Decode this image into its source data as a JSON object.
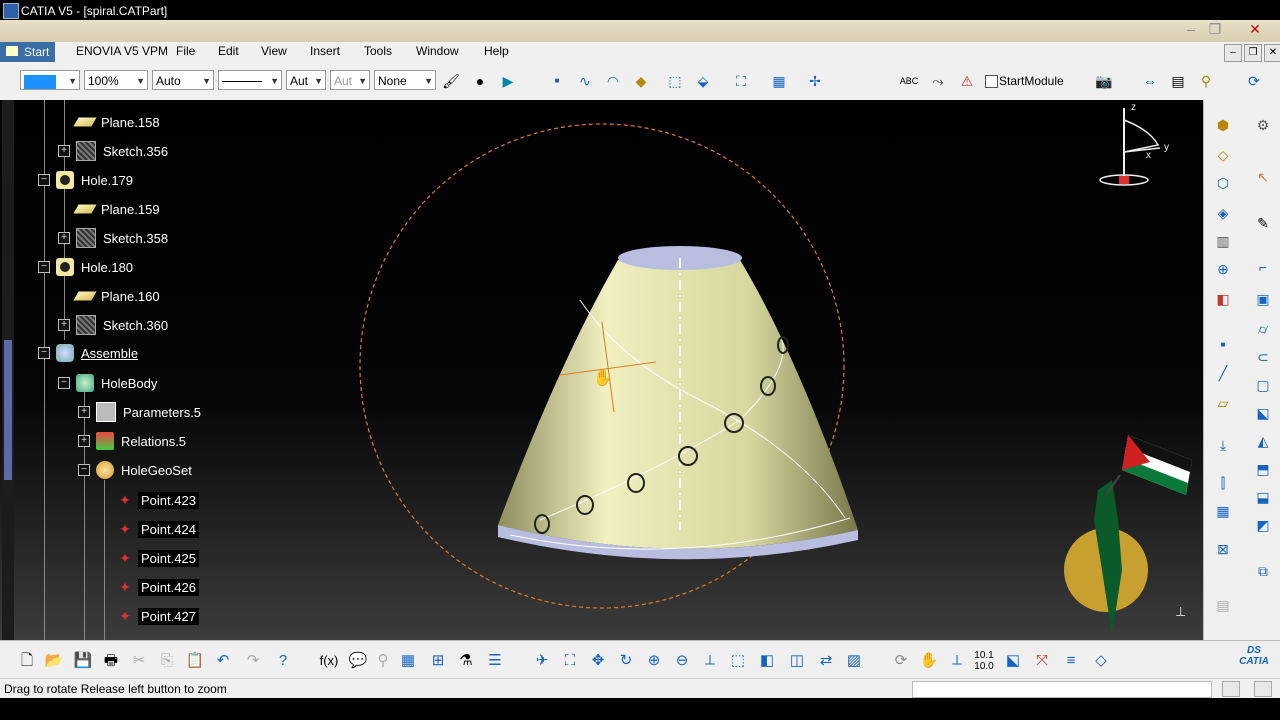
{
  "window": {
    "title": "CATIA V5 - [spiral.CATPart]"
  },
  "menu": [
    "Start",
    "ENOVIA V5 VPM",
    "File",
    "Edit",
    "View",
    "Insert",
    "Tools",
    "Window",
    "Help"
  ],
  "toolbar": {
    "zoom": "100%",
    "auto_label": "Auto",
    "aut1": "Aut",
    "aut2": "Aut",
    "none_label": "None",
    "startmodule": "StartModule"
  },
  "tree": [
    {
      "label": "Plane.158",
      "icon": "plane-icon"
    },
    {
      "label": "Sketch.356",
      "icon": "sketch-icon"
    },
    {
      "label": "Hole.179",
      "icon": "hole-icon"
    },
    {
      "label": "Plane.159",
      "icon": "plane-icon"
    },
    {
      "label": "Sketch.358",
      "icon": "sketch-icon"
    },
    {
      "label": "Hole.180",
      "icon": "hole-icon"
    },
    {
      "label": "Plane.160",
      "icon": "plane-icon"
    },
    {
      "label": "Sketch.360",
      "icon": "sketch-icon"
    },
    {
      "label": "Assemble",
      "icon": "assemble-icon"
    },
    {
      "label": "HoleBody",
      "icon": "body-icon"
    },
    {
      "label": "Parameters.5",
      "icon": "parameters-icon"
    },
    {
      "label": "Relations.5",
      "icon": "relations-icon"
    },
    {
      "label": "HoleGeoSet",
      "icon": "geoset-icon"
    },
    {
      "label": "Point.423",
      "icon": "point-icon"
    },
    {
      "label": "Point.424",
      "icon": "point-icon"
    },
    {
      "label": "Point.425",
      "icon": "point-icon"
    },
    {
      "label": "Point.426",
      "icon": "point-icon"
    },
    {
      "label": "Point.427",
      "icon": "point-icon"
    }
  ],
  "compass": {
    "z": "z",
    "x": "x",
    "y": "y"
  },
  "status": {
    "message": "Drag to rotate  Release left button to zoom"
  },
  "colors": {
    "part": "#e8e8b0",
    "highlight": "#e07a20",
    "menu_active": "#3a6ea5"
  }
}
